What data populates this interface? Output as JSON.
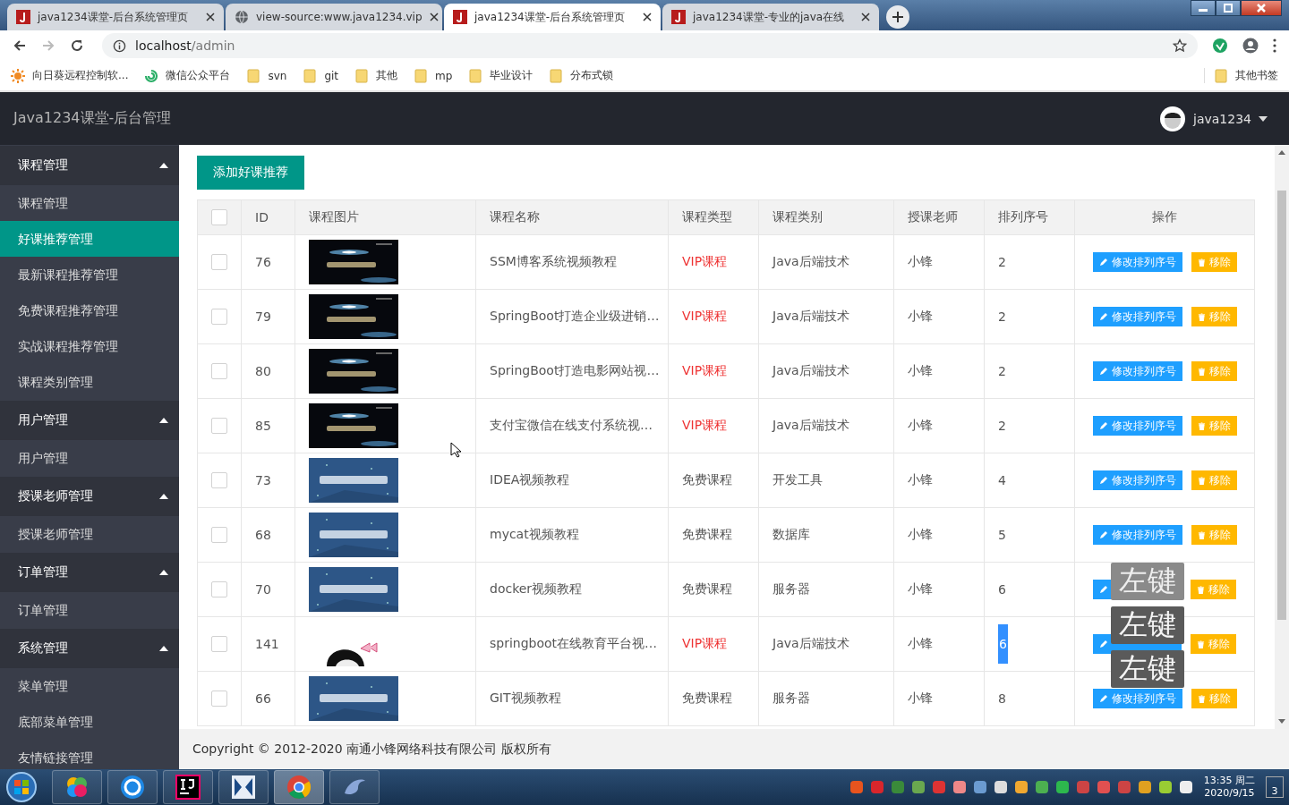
{
  "browser": {
    "tabs": [
      {
        "title": "java1234课堂-后台系统管理页",
        "selected": false
      },
      {
        "title": "view-source:www.java1234.vip",
        "selected": false
      },
      {
        "title": "java1234课堂-后台系统管理页",
        "selected": true
      },
      {
        "title": "java1234课堂-专业的java在线",
        "selected": false
      }
    ],
    "address_host": "localhost",
    "address_path": "/admin",
    "bookmarks": [
      {
        "label": "向日葵远程控制软..."
      },
      {
        "label": "微信公众平台"
      },
      {
        "label": "svn"
      },
      {
        "label": "git"
      },
      {
        "label": "其他"
      },
      {
        "label": "mp"
      },
      {
        "label": "毕业设计"
      },
      {
        "label": "分布式锁"
      }
    ],
    "other_bookmarks": "其他书签"
  },
  "header": {
    "title": "Java1234课堂-后台管理",
    "user": "java1234"
  },
  "sidebar": [
    {
      "label": "课程管理",
      "expanded": true,
      "children": [
        {
          "label": "课程管理",
          "selected": false
        },
        {
          "label": "好课推荐管理",
          "selected": true
        },
        {
          "label": "最新课程推荐管理",
          "selected": false
        },
        {
          "label": "免费课程推荐管理",
          "selected": false
        },
        {
          "label": "实战课程推荐管理",
          "selected": false
        },
        {
          "label": "课程类别管理",
          "selected": false
        }
      ]
    },
    {
      "label": "用户管理",
      "expanded": true,
      "children": [
        {
          "label": "用户管理",
          "selected": false
        }
      ]
    },
    {
      "label": "授课老师管理",
      "expanded": true,
      "children": [
        {
          "label": "授课老师管理",
          "selected": false
        }
      ]
    },
    {
      "label": "订单管理",
      "expanded": true,
      "children": [
        {
          "label": "订单管理",
          "selected": false
        }
      ]
    },
    {
      "label": "系统管理",
      "expanded": true,
      "children": [
        {
          "label": "菜单管理",
          "selected": false
        },
        {
          "label": "底部菜单管理",
          "selected": false
        },
        {
          "label": "友情链接管理",
          "selected": false
        }
      ]
    }
  ],
  "add_button": "添加好课推荐",
  "table": {
    "all_checked": false,
    "columns": [
      "ID",
      "课程图片",
      "课程名称",
      "课程类型",
      "课程类别",
      "授课老师",
      "排列序号",
      "操作"
    ],
    "rows": [
      {
        "checked": false,
        "id": "76",
        "name": "SSM博客系统视频教程",
        "type": "VIP课程",
        "vip": true,
        "category": "Java后端技术",
        "teacher": "小锋",
        "sort": "2",
        "sort_selected": false,
        "edit": "修改排列序号",
        "remove": "移除"
      },
      {
        "checked": false,
        "id": "79",
        "name": "SpringBoot打造企业级进销…",
        "type": "VIP课程",
        "vip": true,
        "category": "Java后端技术",
        "teacher": "小锋",
        "sort": "2",
        "sort_selected": false,
        "edit": "修改排列序号",
        "remove": "移除"
      },
      {
        "checked": false,
        "id": "80",
        "name": "SpringBoot打造电影网站视…",
        "type": "VIP课程",
        "vip": true,
        "category": "Java后端技术",
        "teacher": "小锋",
        "sort": "2",
        "sort_selected": false,
        "edit": "修改排列序号",
        "remove": "移除"
      },
      {
        "checked": false,
        "id": "85",
        "name": "支付宝微信在线支付系统视…",
        "type": "VIP课程",
        "vip": true,
        "category": "Java后端技术",
        "teacher": "小锋",
        "sort": "2",
        "sort_selected": false,
        "edit": "修改排列序号",
        "remove": "移除"
      },
      {
        "checked": false,
        "id": "73",
        "name": "IDEA视频教程",
        "type": "免费课程",
        "vip": false,
        "category": "开发工具",
        "teacher": "小锋",
        "sort": "4",
        "sort_selected": false,
        "edit": "修改排列序号",
        "remove": "移除"
      },
      {
        "checked": false,
        "id": "68",
        "name": "mycat视频教程",
        "type": "免费课程",
        "vip": false,
        "category": "数据库",
        "teacher": "小锋",
        "sort": "5",
        "sort_selected": false,
        "edit": "修改排列序号",
        "remove": "移除"
      },
      {
        "checked": false,
        "id": "70",
        "name": "docker视频教程",
        "type": "免费课程",
        "vip": false,
        "category": "服务器",
        "teacher": "小锋",
        "sort": "6",
        "sort_selected": false,
        "remove": "移除"
      },
      {
        "checked": false,
        "id": "141",
        "name": "springboot在线教育平台视…",
        "type": "VIP课程",
        "vip": true,
        "category": "Java后端技术",
        "teacher": "小锋",
        "sort": "6",
        "sort_selected": true,
        "remove": "移除"
      },
      {
        "checked": false,
        "id": "66",
        "name": "GIT视频教程",
        "type": "免费课程",
        "vip": false,
        "category": "服务器",
        "teacher": "小锋",
        "sort": "8",
        "sort_selected": false,
        "edit": "修改排列序号",
        "remove": "移除"
      }
    ]
  },
  "footer": "Copyright © 2012-2020 南通小锋网络科技有限公司 版权所有",
  "key_overlays": [
    "左键",
    "左键",
    "左键"
  ],
  "taskbar": {
    "time": "13:35 周二",
    "date": "2020/9/15",
    "badge": "3"
  }
}
